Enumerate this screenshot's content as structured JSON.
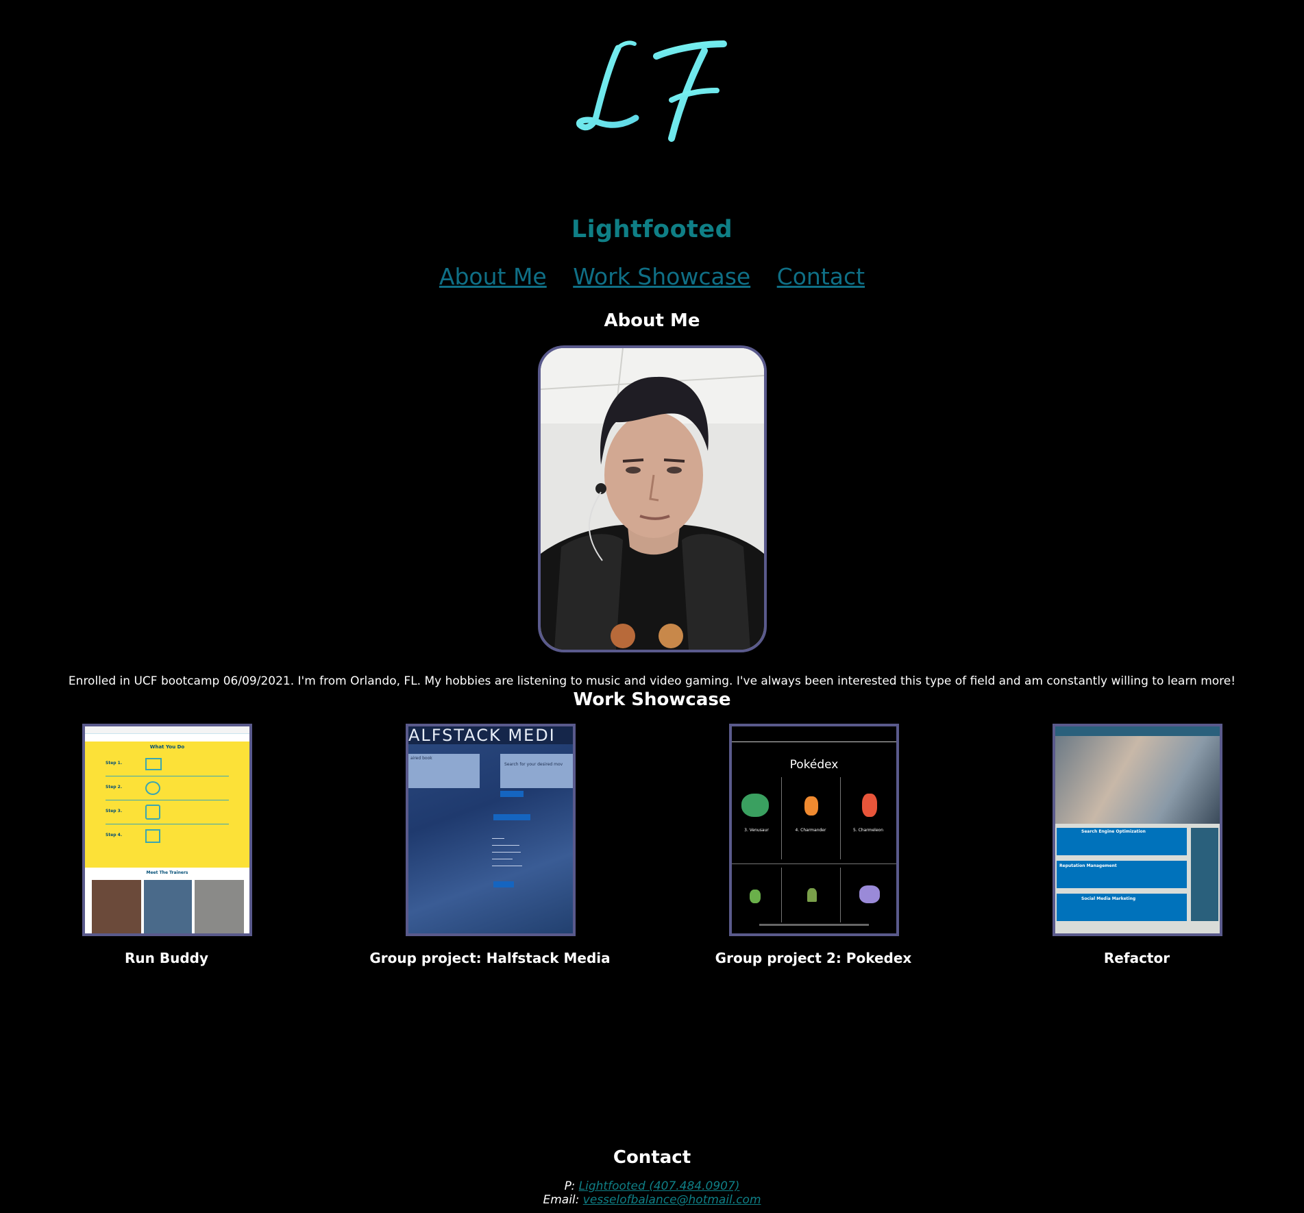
{
  "header": {
    "logo_text": "LF",
    "site_title": "Lightfooted"
  },
  "nav": {
    "items": [
      {
        "label": "About Me"
      },
      {
        "label": "Work Showcase"
      },
      {
        "label": "Contact"
      }
    ]
  },
  "about": {
    "heading": "About Me",
    "bio": "Enrolled in UCF bootcamp 06/09/2021. I'm from Orlando, FL. My hobbies are listening to music and video gaming. I've always been interested this type of field and am constantly willing to learn more!"
  },
  "work": {
    "heading": "Work Showcase",
    "projects": [
      {
        "name": "Run Buddy",
        "thumb": {
          "section_title": "What You Do",
          "steps": [
            "Step 1.",
            "Step 2.",
            "Step 3.",
            "Step 4."
          ],
          "trainers_title": "Meet The Trainers"
        }
      },
      {
        "name": "Group project: Halfstack Media",
        "thumb": {
          "banner": "ALFSTACK MEDI",
          "left_box": "aired book",
          "right_box": "Search for your desired mov"
        }
      },
      {
        "name": "Group project 2: Pokedex",
        "thumb": {
          "title": "Pokédex",
          "cards": [
            "3. Venusaur",
            "4. Charmander",
            "5. Charmeleon"
          ]
        }
      },
      {
        "name": "Refactor",
        "thumb": {
          "rows": [
            "Search Engine Optimization",
            "Reputation Management",
            "Social Media Marketing"
          ]
        }
      }
    ]
  },
  "contact": {
    "heading": "Contact",
    "phone_prefix": "P:",
    "phone_link": "Lightfooted (407.484.0907)",
    "email_prefix": "Email:",
    "email_link": "vesselofbalance@hotmail.com"
  },
  "colors": {
    "background": "#000000",
    "title": "#0f7f86",
    "logo": "#6ff2f2",
    "frame": "#5a5a8c"
  }
}
